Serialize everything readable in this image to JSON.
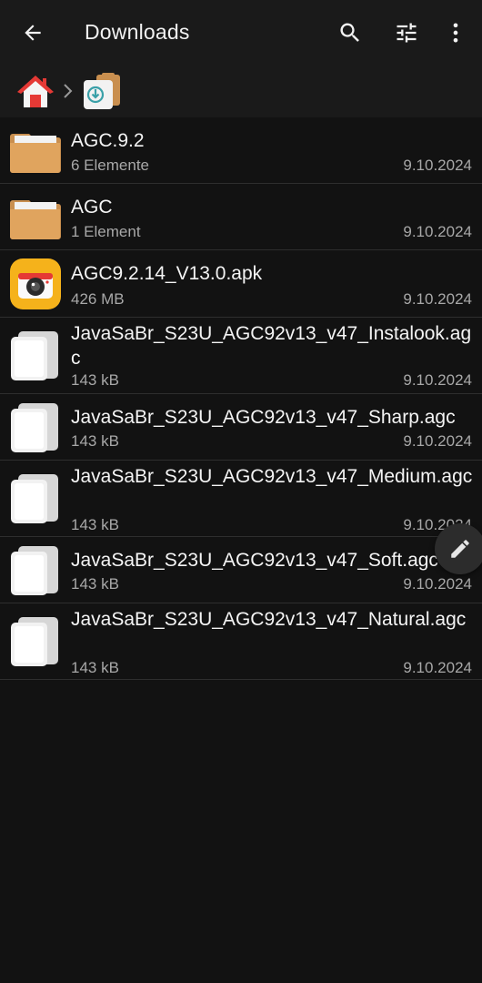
{
  "appbar": {
    "title": "Downloads",
    "actions": [
      {
        "icon": "search-icon"
      },
      {
        "icon": "filter-sliders-icon"
      },
      {
        "icon": "more-vertical-icon"
      }
    ]
  },
  "breadcrumb": {
    "items": [
      {
        "icon": "home-icon"
      },
      {
        "icon": "downloads-folder-icon"
      }
    ]
  },
  "files": [
    {
      "type": "folder",
      "icon": "folder-icon",
      "name": "AGC.9.2",
      "meta": "6 Elemente",
      "date": "9.10.2024"
    },
    {
      "type": "folder",
      "icon": "folder-icon",
      "name": "AGC",
      "meta": "1 Element",
      "date": "9.10.2024"
    },
    {
      "type": "apk",
      "icon": "camera-app-icon",
      "name": "AGC9.2.14_V13.0.apk",
      "meta": "426 MB",
      "date": "9.10.2024"
    },
    {
      "type": "file",
      "icon": "file-icon",
      "name": "JavaSaBr_S23U_AGC92v13_v47_Instalook.agc",
      "meta": "143 kB",
      "date": "9.10.2024"
    },
    {
      "type": "file",
      "icon": "file-icon",
      "name": "JavaSaBr_S23U_AGC92v13_v47_Sharp.agc",
      "meta": "143 kB",
      "date": "9.10.2024"
    },
    {
      "type": "file",
      "icon": "file-icon",
      "name": "JavaSaBr_S23U_AGC92v13_v47_Medium.agc",
      "meta": "143 kB",
      "date": "9.10.2024"
    },
    {
      "type": "file",
      "icon": "file-icon",
      "name": "JavaSaBr_S23U_AGC92v13_v47_Soft.agc",
      "meta": "143 kB",
      "date": "9.10.2024"
    },
    {
      "type": "file",
      "icon": "file-icon",
      "name": "JavaSaBr_S23U_AGC92v13_v47_Natural.agc",
      "meta": "143 kB",
      "date": "9.10.2024"
    }
  ],
  "fab": {
    "icon": "edit-pencil-icon"
  },
  "colors": {
    "background": "#121212",
    "bar": "#1a1a1a",
    "folder": "#e0a45e",
    "secondary_text": "#a8a8a8"
  }
}
